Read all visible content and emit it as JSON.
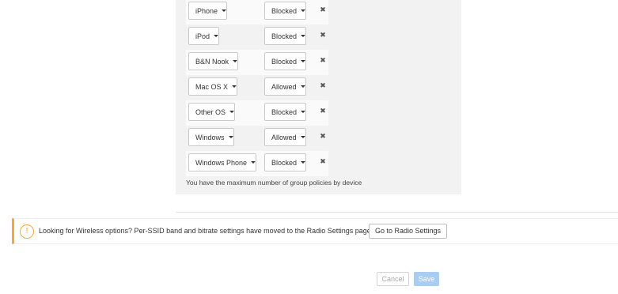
{
  "group_policies": {
    "rows": [
      {
        "device": "iPhone",
        "policy": "Blocked",
        "remove_icon": "close-icon"
      },
      {
        "device": "iPod",
        "policy": "Blocked",
        "remove_icon": "close-icon"
      },
      {
        "device": "B&N Nook",
        "policy": "Blocked",
        "remove_icon": "close-icon"
      },
      {
        "device": "Mac OS X",
        "policy": "Allowed",
        "remove_icon": "close-icon"
      },
      {
        "device": "Other OS",
        "policy": "Blocked",
        "remove_icon": "close-icon"
      },
      {
        "device": "Windows",
        "policy": "Allowed",
        "remove_icon": "close-icon"
      },
      {
        "device": "Windows Phone",
        "policy": "Blocked",
        "remove_icon": "close-icon"
      }
    ],
    "max_note": "You have the maximum number of group policies by device"
  },
  "notice": {
    "icon": "warning-icon",
    "text": "Looking for Wireless options? Per-SSID band and bitrate settings have moved to the Radio Settings page.",
    "button_label": "Go to Radio Settings",
    "accent_color": "#f2a93b"
  },
  "footer": {
    "cancel_label": "Cancel",
    "save_label": "Save",
    "save_color": "#a9cdf2"
  }
}
